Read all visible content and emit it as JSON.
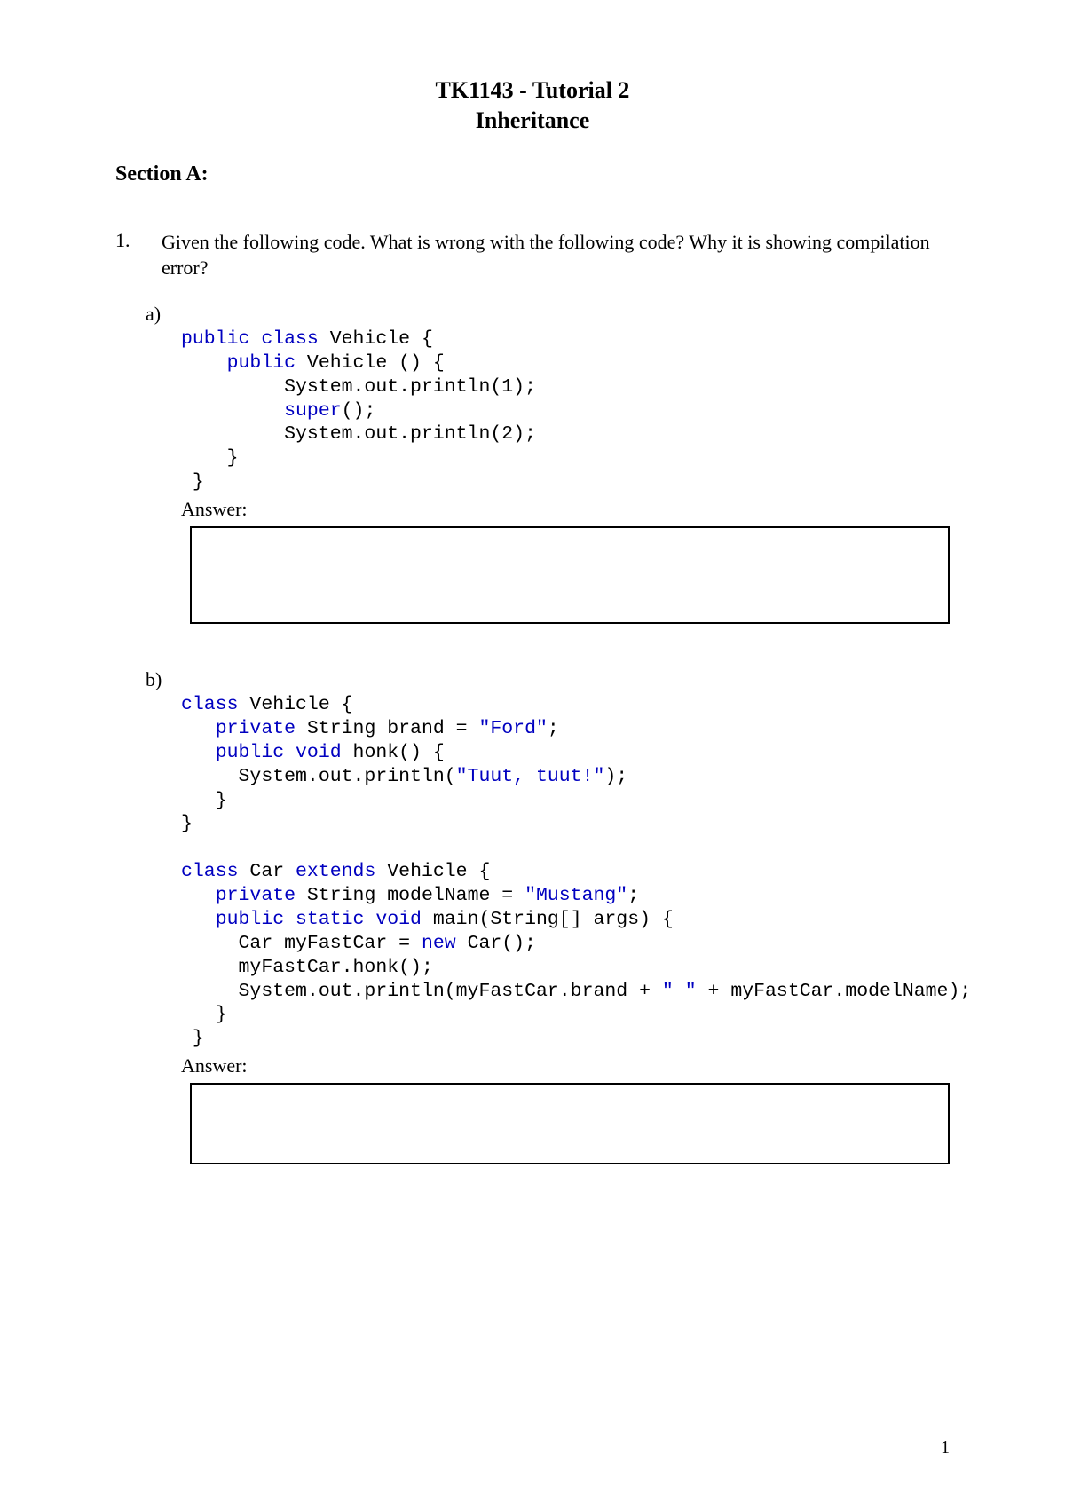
{
  "header": {
    "line1": "TK1143 - Tutorial 2",
    "line2": "Inheritance"
  },
  "section": "Section A:",
  "q1": {
    "num": "1.",
    "lead": "Given the following code",
    "rest": ". What is wrong with the following code? Why it is showing compilation error?"
  },
  "a": {
    "label": "a)",
    "code": {
      "l1a": "public",
      "l1b": " class",
      "l1c": " Vehicle {",
      "l2a": "    public",
      "l2b": " Vehicle () {",
      "l3": "         System.out.println(1);",
      "l4a": "         super",
      "l4b": "();",
      "l5": "         System.out.println(2);",
      "l6": "    }",
      "l7": " }"
    },
    "answer_label": "Answer:",
    "answer_height": 110
  },
  "b": {
    "label": "b)",
    "code": {
      "l1a": "class",
      "l1b": " Vehicle {",
      "l2a": "   private",
      "l2b": " String brand = ",
      "l2c": "\"Ford\"",
      "l2d": ";",
      "l3a": "   public",
      "l3b": " void",
      "l3c": " honk() {",
      "l4a": "     System.out.println(",
      "l4b": "\"Tuut, tuut!\"",
      "l4c": ");",
      "l5": "   }",
      "l6": "}",
      "blank": "",
      "l7a": "class",
      "l7b": " Car ",
      "l7c": "extends",
      "l7d": " Vehicle {",
      "l8a": "   private",
      "l8b": " String modelName = ",
      "l8c": "\"Mustang\"",
      "l8d": ";",
      "l9a": "   public",
      "l9b": " static",
      "l9c": " void",
      "l9d": " main(String[] args) {",
      "l10a": "     Car myFastCar = ",
      "l10b": "new",
      "l10c": " Car();",
      "l11": "     myFastCar.honk();",
      "l12a": "     System.out.println(myFastCar.brand + ",
      "l12b": "\" \"",
      "l12c": " + myFastCar.modelName);",
      "l13": "   }",
      "l14": " }"
    },
    "answer_label": "Answer:",
    "answer_height": 92
  },
  "page_number": "1"
}
